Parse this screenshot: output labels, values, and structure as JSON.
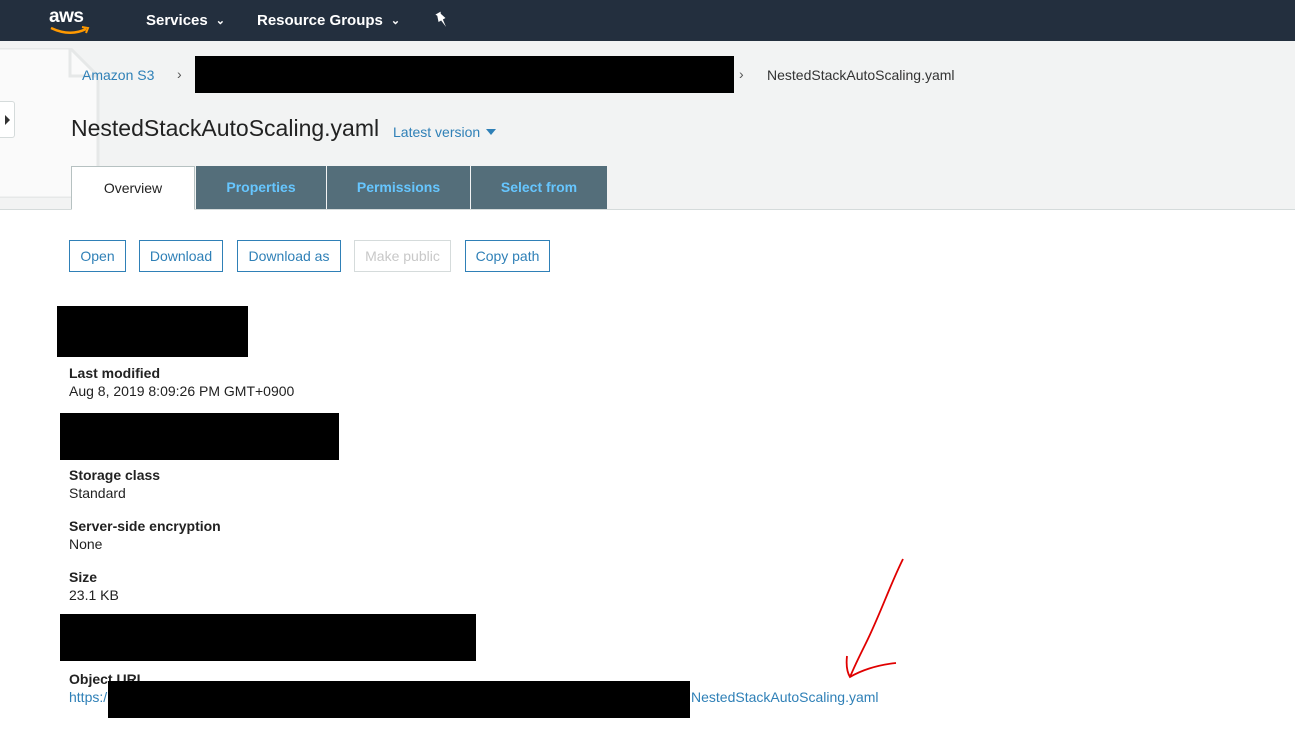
{
  "topnav": {
    "logo_text": "aws",
    "services_label": "Services",
    "resource_groups_label": "Resource Groups",
    "pin_icon": "pin-icon"
  },
  "breadcrumb": {
    "root": "Amazon S3",
    "file": "NestedStackAutoScaling.yaml"
  },
  "page": {
    "title": "NestedStackAutoScaling.yaml",
    "version_label": "Latest version"
  },
  "tabs": [
    {
      "label": "Overview",
      "active": true
    },
    {
      "label": "Properties",
      "active": false
    },
    {
      "label": "Permissions",
      "active": false
    },
    {
      "label": "Select from",
      "active": false
    }
  ],
  "actions": {
    "open": "Open",
    "download": "Download",
    "download_as": "Download as",
    "make_public": "Make public",
    "copy_path": "Copy path"
  },
  "details": {
    "last_modified_label": "Last modified",
    "last_modified_value": "Aug 8, 2019 8:09:26 PM GMT+0900",
    "storage_class_label": "Storage class",
    "storage_class_value": "Standard",
    "sse_label": "Server-side encryption",
    "sse_value": "None",
    "size_label": "Size",
    "size_value": "23.1 KB",
    "object_url_label": "Object URL",
    "object_url_prefix": "https:/",
    "object_url_file": "NestedStackAutoScaling.yaml"
  },
  "colors": {
    "nav_bg": "#232f3e",
    "link": "#2f80b7",
    "tab_bg": "#546e7a",
    "tab_text": "#66c6ff",
    "annotation": "#e00000"
  }
}
